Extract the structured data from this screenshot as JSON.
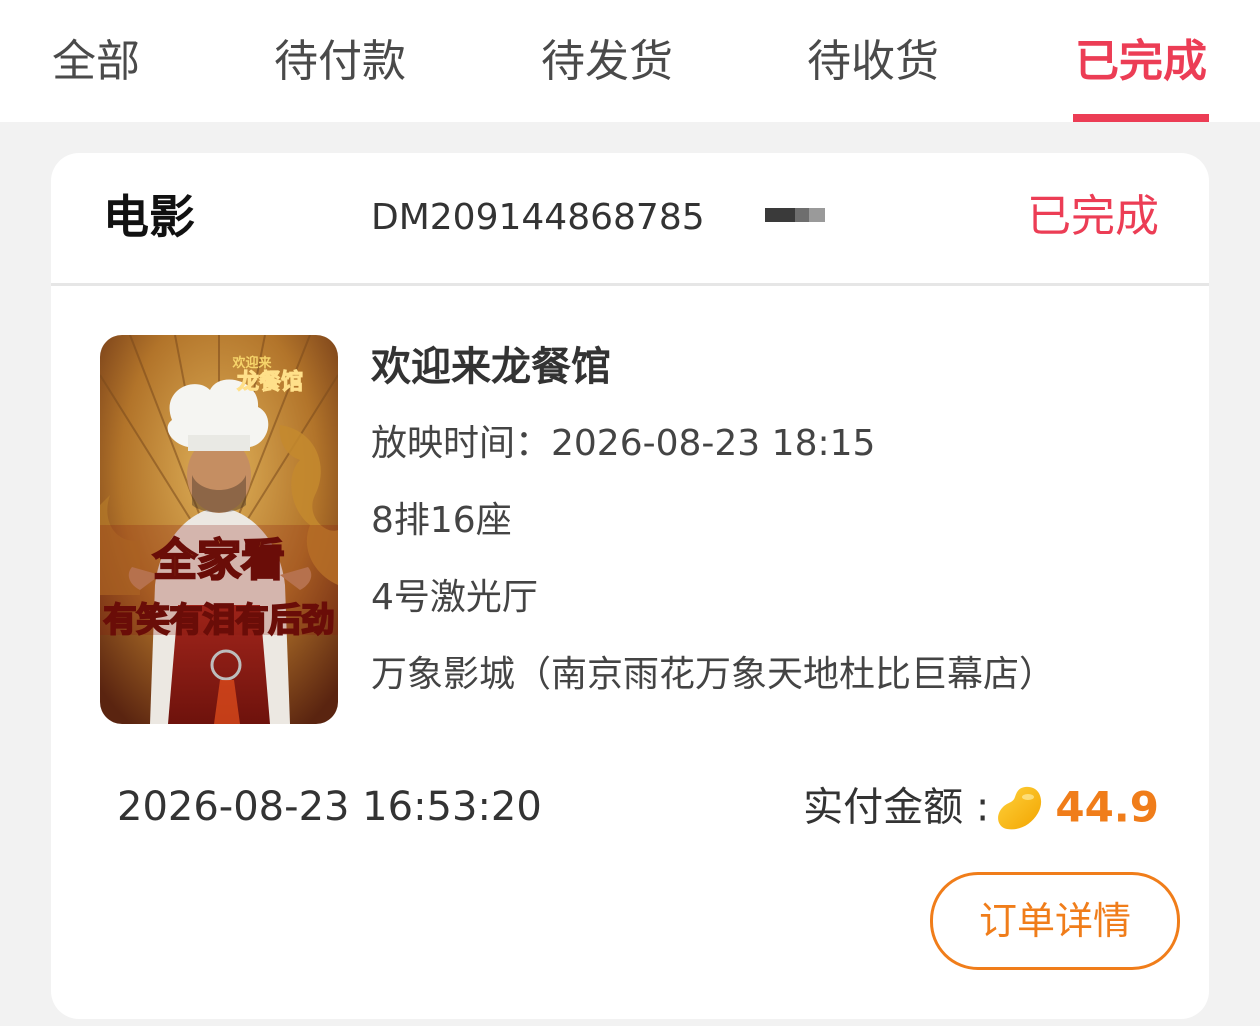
{
  "tabs": [
    {
      "label": "全部",
      "active": false
    },
    {
      "label": "待付款",
      "active": false
    },
    {
      "label": "待发货",
      "active": false
    },
    {
      "label": "待收货",
      "active": false
    },
    {
      "label": "已完成",
      "active": true
    }
  ],
  "order": {
    "category": "电影",
    "order_no": "DM209144868785",
    "status": "已完成",
    "movie_title": "欢迎来龙餐馆",
    "showtime": "放映时间：2026-08-23 18:15",
    "seat": "8排16座",
    "hall": "4号激光厅",
    "cinema": "万象影城（南京雨花万象天地杜比巨幕店）",
    "order_time": "2026-08-23 16:53:20",
    "paid_label": "实付金额 :",
    "paid_amount": "44.9",
    "detail_button": "订单详情"
  },
  "poster": {
    "logo_top": "欢迎来",
    "logo_main": "龙餐馆",
    "tagline_1": "全家看",
    "tagline_2": "有笑有泪有后劲"
  },
  "colors": {
    "accent": "#ec3d55",
    "amount": "#f07d1a",
    "background": "#f2f2f2"
  },
  "icons": {
    "currency": "coin-bean-icon"
  }
}
